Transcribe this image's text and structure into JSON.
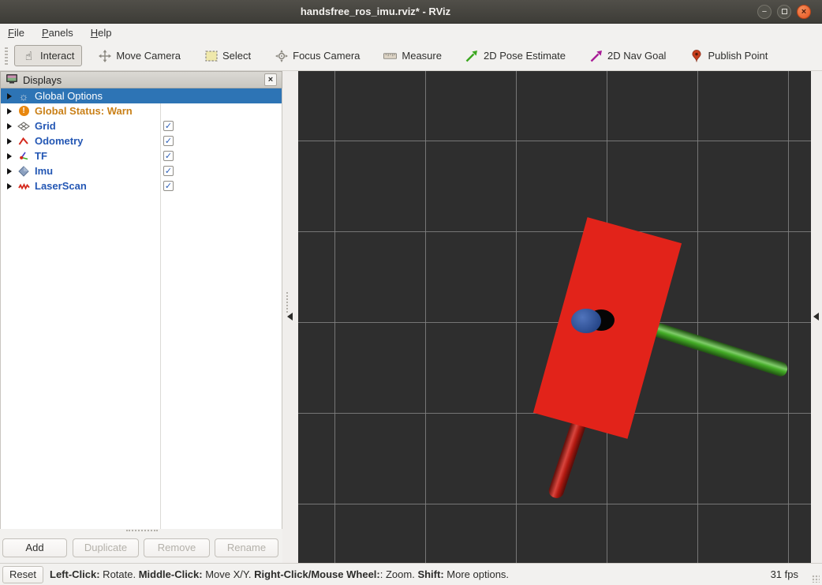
{
  "window": {
    "title": "handsfree_ros_imu.rviz* - RViz",
    "controls": {
      "minimize": "minimize",
      "maximize": "maximize",
      "close": "close"
    }
  },
  "menu": {
    "items": [
      {
        "label": "File"
      },
      {
        "label": "Panels"
      },
      {
        "label": "Help"
      }
    ]
  },
  "toolbar": {
    "tools": [
      {
        "label": "Interact",
        "icon": "hand-icon",
        "active": true
      },
      {
        "label": "Move Camera",
        "icon": "move-arrows-icon",
        "active": false
      },
      {
        "label": "Select",
        "icon": "selection-box-icon",
        "active": false
      },
      {
        "label": "Focus Camera",
        "icon": "focus-crosshair-icon",
        "active": false
      },
      {
        "label": "Measure",
        "icon": "ruler-icon",
        "active": false
      },
      {
        "label": "2D Pose Estimate",
        "icon": "green-arrow-icon",
        "active": false
      },
      {
        "label": "2D Nav Goal",
        "icon": "purple-arrow-icon",
        "active": false
      },
      {
        "label": "Publish Point",
        "icon": "map-pin-icon",
        "active": false
      }
    ]
  },
  "displays_panel": {
    "title": "Displays",
    "header_icon": "monitor-icon",
    "close_label": "×",
    "rows": [
      {
        "label": "Global Options",
        "icon": "gear-icon",
        "selected": true,
        "warn": false,
        "checkbox": null
      },
      {
        "label": "Global Status: Warn",
        "icon": "warning-icon",
        "selected": false,
        "warn": true,
        "checkbox": null
      },
      {
        "label": "Grid",
        "icon": "grid-icon",
        "selected": false,
        "warn": false,
        "checkbox": true
      },
      {
        "label": "Odometry",
        "icon": "odometry-icon",
        "selected": false,
        "warn": false,
        "checkbox": true
      },
      {
        "label": "TF",
        "icon": "tf-axes-icon",
        "selected": false,
        "warn": false,
        "checkbox": true
      },
      {
        "label": "Imu",
        "icon": "imu-icon",
        "selected": false,
        "warn": false,
        "checkbox": true
      },
      {
        "label": "LaserScan",
        "icon": "laserscan-icon",
        "selected": false,
        "warn": false,
        "checkbox": true
      }
    ],
    "buttons": [
      {
        "label": "Add",
        "enabled": true
      },
      {
        "label": "Duplicate",
        "enabled": false
      },
      {
        "label": "Remove",
        "enabled": false
      },
      {
        "label": "Rename",
        "enabled": false
      }
    ]
  },
  "viewport": {
    "background": "#2e2e2e",
    "grid_color": "#828282",
    "objects": [
      "red-box",
      "green-cylinder",
      "red-cylinder",
      "blue-cylinder-cap"
    ],
    "colors": {
      "red_box": "#e2231a",
      "green_cylinder": "#46b427",
      "red_cylinder": "#d01d13",
      "blue_cap": "#2a55ad",
      "selection_blue": "#2d74b5",
      "label_blue": "#2457b4",
      "warn_orange": "#c98018"
    }
  },
  "status_bar": {
    "reset_label": "Reset",
    "hints": [
      {
        "key": "Left-Click:",
        "text": " Rotate. "
      },
      {
        "key": "Middle-Click:",
        "text": " Move X/Y. "
      },
      {
        "key": "Right-Click/Mouse Wheel:",
        "text": ": Zoom. "
      },
      {
        "key": "Shift:",
        "text": " More options."
      }
    ],
    "fps": "31 fps"
  }
}
